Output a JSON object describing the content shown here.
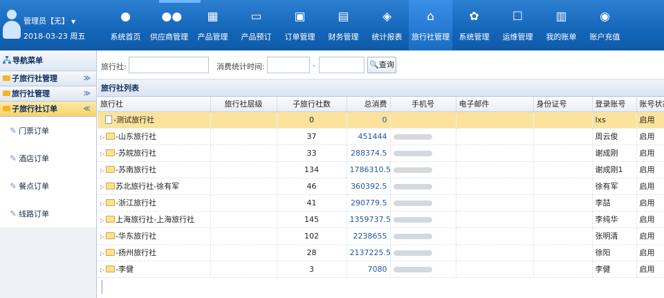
{
  "user": {
    "name": "管理员【无】",
    "date": "2018-03-23 周五"
  },
  "nav": [
    {
      "label": "系统首页",
      "icon": "user-icon"
    },
    {
      "label": "供应商管理",
      "icon": "users-icon"
    },
    {
      "label": "产品管理",
      "icon": "product-icon"
    },
    {
      "label": "产品预订",
      "icon": "booking-icon"
    },
    {
      "label": "订单管理",
      "icon": "order-icon"
    },
    {
      "label": "财务管理",
      "icon": "calculator-icon"
    },
    {
      "label": "统计报表",
      "icon": "tag-icon"
    },
    {
      "label": "旅行社管理",
      "icon": "home-icon",
      "active": true
    },
    {
      "label": "系统管理",
      "icon": "gear-icon"
    },
    {
      "label": "运维管理",
      "icon": "chat-icon"
    },
    {
      "label": "我的账单",
      "icon": "bill-icon"
    },
    {
      "label": "账户充值",
      "icon": "recharge-icon"
    }
  ],
  "sidebar": {
    "title": "导航菜单",
    "groups": [
      {
        "label": "子旅行社管理"
      },
      {
        "label": "旅行社管理"
      },
      {
        "label": "子旅行社订单"
      }
    ],
    "links": [
      "门票订单",
      "酒店订单",
      "餐点订单",
      "线路订单"
    ]
  },
  "search": {
    "agency_label": "旅行社:",
    "time_label": "消费统计时间:",
    "range_sep": "-",
    "query_button": "查询"
  },
  "list": {
    "title": "旅行社列表",
    "columns": [
      "旅行社",
      "旅行社层级",
      "子旅行社数",
      "总消费",
      "手机号",
      "电子邮件",
      "身份证号",
      "登录账号",
      "账号状态"
    ],
    "rows": [
      {
        "name": "-测试旅行社",
        "level": "",
        "sub": "0",
        "total": "0",
        "phone": "",
        "email": "",
        "id": "",
        "login": "lxs",
        "status": "启用",
        "selected": true,
        "leaf": true
      },
      {
        "name": "-山东旅行社",
        "level": "",
        "sub": "37",
        "total": "451444",
        "phone": "blurred",
        "email": "",
        "id": "",
        "login": "周云俊",
        "status": "启用"
      },
      {
        "name": "-苏皖旅行社",
        "level": "",
        "sub": "33",
        "total": "288374.5",
        "phone": "blurred",
        "email": "",
        "id": "",
        "login": "谢成刚",
        "status": "启用"
      },
      {
        "name": "-苏南旅行社",
        "level": "",
        "sub": "134",
        "total": "1786310.5",
        "phone": "blurred",
        "email": "",
        "id": "",
        "login": "谢成刚1",
        "status": "启用"
      },
      {
        "name": "苏北旅行社-徐有军",
        "level": "",
        "sub": "46",
        "total": "360392.5",
        "phone": "blurred",
        "email": "",
        "id": "",
        "login": "徐有军",
        "status": "启用"
      },
      {
        "name": "-浙江旅行社",
        "level": "",
        "sub": "41",
        "total": "290779.5",
        "phone": "blurred",
        "email": "",
        "id": "",
        "login": "李喆",
        "status": "启用"
      },
      {
        "name": "上海旅行社-上海旅行社",
        "level": "",
        "sub": "145",
        "total": "1359737.5",
        "phone": "blurred",
        "email": "",
        "id": "",
        "login": "李纯华",
        "status": "启用"
      },
      {
        "name": "-华东旅行社",
        "level": "",
        "sub": "102",
        "total": "2238655",
        "phone": "blurred",
        "email": "",
        "id": "",
        "login": "张明清",
        "status": "启用"
      },
      {
        "name": "-扬州旅行社",
        "level": "",
        "sub": "28",
        "total": "2137225.5",
        "phone": "blurred",
        "email": "",
        "id": "",
        "login": "徐阳",
        "status": "启用"
      },
      {
        "name": "-李健",
        "level": "",
        "sub": "3",
        "total": "7080",
        "phone": "blurred",
        "email": "",
        "id": "",
        "login": "李健",
        "status": "启用"
      }
    ]
  }
}
